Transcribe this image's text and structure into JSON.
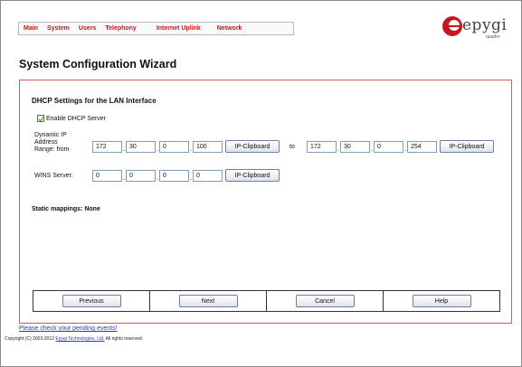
{
  "nav": {
    "items": [
      {
        "label": "Main"
      },
      {
        "label": "System"
      },
      {
        "label": "Users"
      },
      {
        "label": "Telephony"
      },
      {
        "label": "Internet Uplink"
      },
      {
        "label": "Network"
      }
    ]
  },
  "logo": {
    "text": "epygi",
    "sub": "quadro"
  },
  "page": {
    "title": "System Configuration Wizard"
  },
  "section": {
    "title": "DHCP Settings for the LAN Interface"
  },
  "dhcp": {
    "enable_label": "Enable DHCP Server",
    "enabled": true,
    "range_label_1": "Dynamic IP",
    "range_label_2": "Address",
    "range_label_3": "Range: from",
    "from": [
      "172",
      "30",
      "0",
      "100"
    ],
    "to_label": "to",
    "to": [
      "172",
      "30",
      "0",
      "254"
    ],
    "clipboard_label": "IP-Clipboard"
  },
  "wins": {
    "label": "WINS Server:",
    "ip": [
      "0",
      "0",
      "0",
      "0"
    ]
  },
  "static_mappings": "Static mappings: None",
  "buttons": {
    "previous": "Previous",
    "next": "Next",
    "cancel": "Cancel",
    "help": "Help"
  },
  "footer": {
    "pending": "Please check your pending events!",
    "copyright_prefix": "Copyright (C) 2003-2012",
    "company": "Epygi Technologies, Ltd.",
    "rights": "All rights reserved."
  },
  "colors": {
    "nav": "#c0171d",
    "logo_red": "#c8161d",
    "panel_border": "#d25a5a"
  }
}
